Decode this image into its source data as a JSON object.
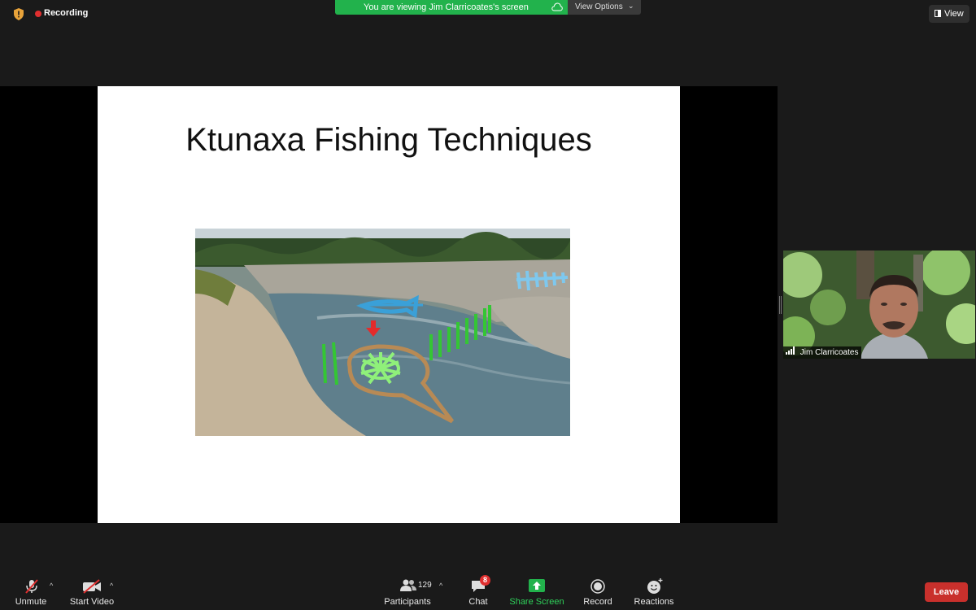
{
  "recording": {
    "label": "Recording"
  },
  "banner": {
    "text": "You are viewing Jim Clarricoates's screen"
  },
  "view_options": {
    "label": "View Options",
    "caret": "⌄"
  },
  "view_button": {
    "label": "View"
  },
  "slide": {
    "title": "Ktunaxa Fishing Techniques"
  },
  "participant": {
    "name": "Jim Clarricoates"
  },
  "toolbar": {
    "unmute": "Unmute",
    "start_video": "Start Video",
    "participants": "Participants",
    "participants_count": "129",
    "chat": "Chat",
    "chat_badge": "8",
    "share_screen": "Share Screen",
    "record": "Record",
    "reactions": "Reactions",
    "leave": "Leave",
    "caret": "^"
  },
  "colors": {
    "share_green": "#22b24c",
    "leave_red": "#c9302c",
    "recording_red": "#e02f2f",
    "badge_red": "#e02f2f"
  },
  "icons": [
    "shield-icon",
    "cloud-icon",
    "view-icon",
    "mic-muted-icon",
    "video-off-icon",
    "participants-icon",
    "chat-icon",
    "share-screen-icon",
    "record-icon",
    "reactions-icon",
    "signal-bars-icon"
  ]
}
